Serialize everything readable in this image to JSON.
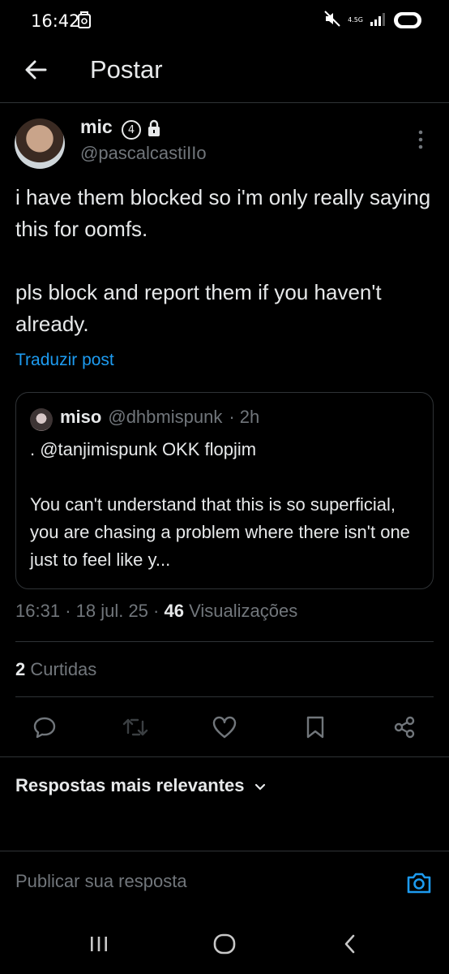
{
  "status_bar": {
    "time": "16:42",
    "network": "4.5G"
  },
  "header": {
    "title": "Postar"
  },
  "post": {
    "author_name": "mic",
    "author_badge": "4",
    "author_handle": "@pascalcastiIIo",
    "text": "i have them blocked so i'm only really saying this for oomfs.\n\npls block and report them if you haven't already.",
    "translate_label": "Traduzir post",
    "quoted": {
      "name": "miso",
      "handle": "@dhbmispunk",
      "time": "· 2h",
      "text": ". @tanjimispunk OKK flopjim\n\nYou can't understand that this is so superficial, you are chasing a problem where there isn't one just to feel like y..."
    },
    "time": "16:31",
    "date": "· 18 jul. 25 ·",
    "views_count": "46",
    "views_label": "Visualizações",
    "likes_count": "2",
    "likes_label": "Curtidas"
  },
  "replies": {
    "sort_label": "Respostas mais relevantes"
  },
  "reply_box": {
    "placeholder": "Publicar sua resposta"
  },
  "colors": {
    "accent": "#1d9bf0",
    "muted": "#71767b",
    "divider": "#2f3336"
  }
}
